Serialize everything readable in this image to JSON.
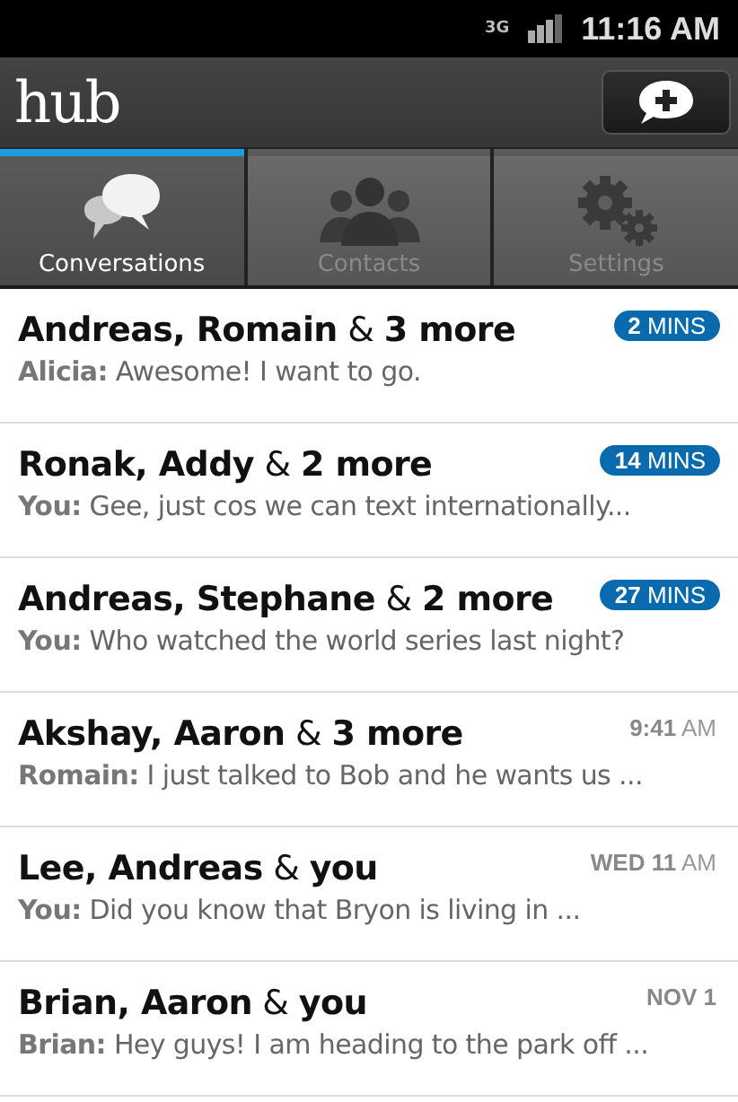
{
  "status_bar": {
    "network": "3G",
    "time": "11:16 AM"
  },
  "app_bar": {
    "title": "hub"
  },
  "tabs": [
    {
      "label": "Conversations",
      "kind": "chat",
      "selected": true
    },
    {
      "label": "Contacts",
      "kind": "people",
      "selected": false
    },
    {
      "label": "Settings",
      "kind": "gears",
      "selected": false
    }
  ],
  "conversations": [
    {
      "title": "**Andreas, Romain** & **3 more**",
      "preview": "**Alicia:** Awesome! I want to go.",
      "time": "**2** MINS",
      "recent": true
    },
    {
      "title": "**Ronak, Addy** & **2 more**",
      "preview": "**You:** Gee, just cos we can text internationally...",
      "time": "**14** MINS",
      "recent": true
    },
    {
      "title": "**Andreas, Stephane** & **2 more**",
      "preview": "**You:** Who watched the world series last night?",
      "time": "**27** MINS",
      "recent": true
    },
    {
      "title": "**Akshay, Aaron** & **3 more**",
      "preview": "**Romain:** I just talked to Bob and he wants us ...",
      "time": "**9:41** AM",
      "recent": false
    },
    {
      "title": "**Lee, Andreas** & **you**",
      "preview": "**You:** Did you know that Bryon is living in ...",
      "time": "**WED 11** AM",
      "recent": false
    },
    {
      "title": "**Brian, Aaron** & **you**",
      "preview": "**Brian:** Hey guys! I am heading to the park off ...",
      "time": "**NOV 1**",
      "recent": false
    }
  ]
}
